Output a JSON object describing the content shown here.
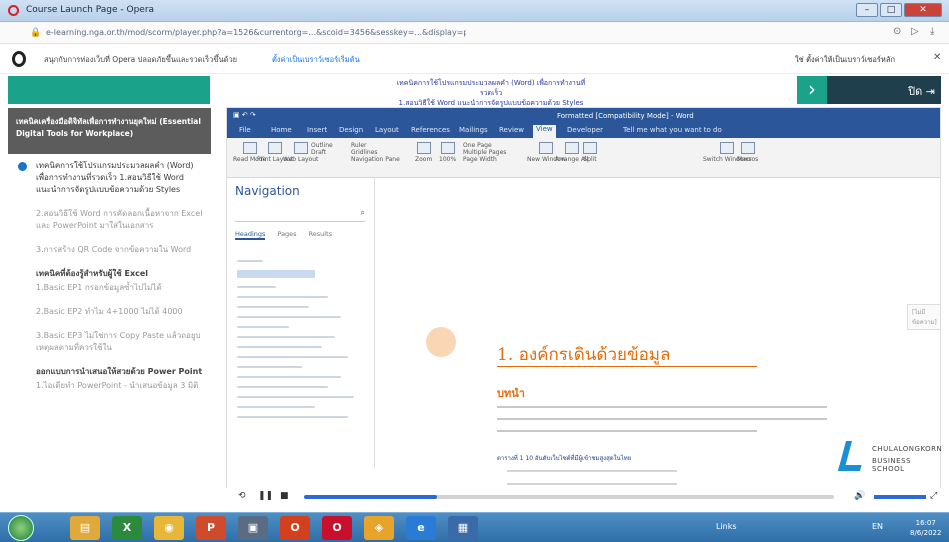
{
  "window": {
    "title": "Course Launch Page - Opera",
    "min": "–",
    "max": "□",
    "close": "✕"
  },
  "address": {
    "url": "e-learning.nga.or.th/mod/scorm/player.php?a=1526&currentorg=...&scoid=3456&sesskey=...&display=popup&mode=normal",
    "lock": "🔒"
  },
  "promo": {
    "message": "สนุกกับการท่องเว็บที่ Opera ปลอดภัยขึ้นและรวดเร็วขึ้นด้วย",
    "link": "ตั้งค่าเป็นเบราว์เซอร์เริ่มต้น",
    "right": "ใช่ ตั้งค่าให้เป็นเบราว์เซอร์หลัก",
    "close": "✕"
  },
  "course": {
    "title_line1": "เทคนิคการใช้โปรแกรมประมวลผลคำ (Word) เพื่อการทำงานที่รวดเร็ว",
    "title_line2": "1.สอนวิธีใช้ Word แนะนำการจัดรูปแบบข้อความด้วย Styles",
    "next": "›",
    "exit": "ปิด ⇥"
  },
  "sidebar": {
    "header": "เทคนิคเครื่องมือดิจิทัลเพื่อการทำงานยุคใหม่ (Essential Digital Tools for Workplace)",
    "items": [
      {
        "text": "เทคนิคการใช้โปรแกรมประมวลผลคำ (Word) เพื่อการทำงานที่รวดเร็ว 1.สอนวิธีใช้ Word แนะนำการจัดรูปแบบข้อความด้วย Styles"
      },
      {
        "text": "2.สอนวิธีใช้ Word การคัดลอกเนื้อหาจาก Excel และ PowerPoint มาใส่ในเอกสาร"
      },
      {
        "text": "3.การสร้าง QR Code จากข้อความใน Word"
      },
      {
        "section": "เทคนิคที่ต้องรู้สำหรับผู้ใช้ Excel",
        "text": "1.Basic EP1 กรอกข้อมูลซ้ำไปไม่ได้"
      },
      {
        "text": "2.Basic EP2 ทำไม 4+1000 ไม่ได้ 4000"
      },
      {
        "text": "3.Basic EP3 ไม่ใช่การ Copy Paste แล้วถอยูบเหตุผลตามที่ควรใช้ใน"
      },
      {
        "section": "ออกแบบการนำเสนอให้สวยด้วย Power Point",
        "text": "1.ไอเดียทำ PowerPoint - นำเสนอข้อมูล 3 มิติ"
      }
    ]
  },
  "word": {
    "title": "Formatted [Compatibility Mode] - Word",
    "tabs": [
      "File",
      "Home",
      "Insert",
      "Design",
      "Layout",
      "References",
      "Mailings",
      "Review",
      "View",
      "Developer"
    ],
    "tellme": "Tell me what you want to do",
    "ribbon": [
      "Read Mode",
      "Print Layout",
      "Web Layout",
      "Outline",
      "Draft",
      "Ruler",
      "Gridlines",
      "Navigation Pane",
      "Zoom",
      "100%",
      "One Page",
      "Multiple Pages",
      "Page Width",
      "New Window",
      "Arrange All",
      "Split",
      "Switch Windows",
      "Macros"
    ],
    "nav": {
      "title": "Navigation",
      "tabs": [
        "Headings",
        "Pages",
        "Results"
      ],
      "search_icon": "⌕"
    },
    "doc": {
      "h1": "1. องค์กรเดินด้วยข้อมูล",
      "h2": "บทนำ",
      "caption": "ตารางที่ 1  10 อันดับเว็บไซต์ที่มีผู้เข้าชมสูงสุดในไทย",
      "badge": "[ไม่มีข้อความ]"
    }
  },
  "logo": {
    "line1": "CHULALONGKORN",
    "line2": "BUSINESS SCHOOL"
  },
  "player": {
    "progress_pct": 25,
    "replay": "⟲",
    "pause": "❚❚",
    "stop": "■",
    "volume": "🔊",
    "fullscreen": "⤢"
  },
  "taskbar": {
    "links": "Links",
    "lang": "EN",
    "time": "16:07",
    "date": "8/6/2022"
  }
}
